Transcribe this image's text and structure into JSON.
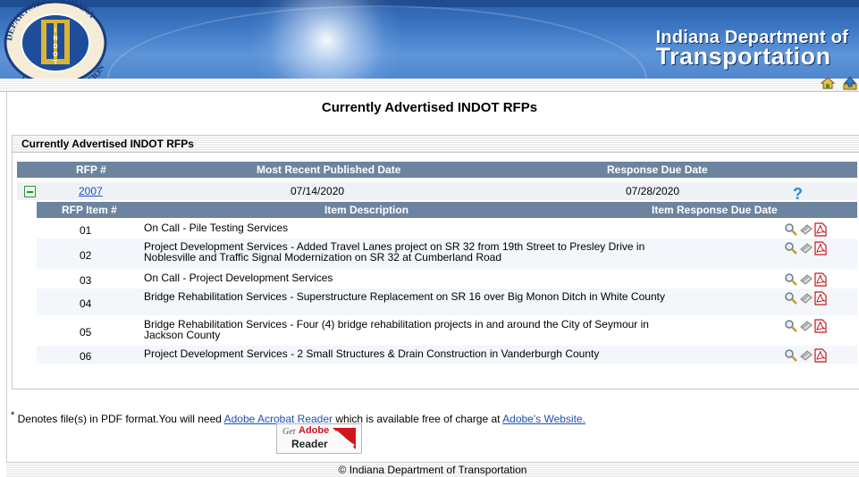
{
  "banner": {
    "title_line1": "Indiana Department of",
    "title_line2": "Transportation",
    "seal_text_top": "INDIANA",
    "seal_text_bottom": "OF TRANSPORTATION",
    "seal_text_left": "DEPARTMENT",
    "seal_center": "INDOT",
    "icons": [
      "home-icon",
      "up-arrow-icon"
    ]
  },
  "page_title": "Currently Advertised INDOT RFPs",
  "panel": {
    "heading": "Currently Advertised INDOT RFPs",
    "columns": {
      "rfp": "RFP #",
      "published": "Most Recent Published Date",
      "due": "Response Due Date"
    },
    "rfp": {
      "number": "2007",
      "published": "07/14/2020",
      "due": "07/28/2020",
      "help_icon": "question-icon"
    },
    "item_columns": {
      "item": "RFP Item #",
      "description": "Item Description",
      "due": "Item Response Due Date"
    },
    "items": [
      {
        "num": "01",
        "desc": "On Call - Pile Testing Services"
      },
      {
        "num": "02",
        "desc": "Project Development Services - Added Travel Lanes project on SR 32 from 19th Street to Presley Drive in Noblesville and Traffic Signal Modernization on SR 32 at Cumberland Road"
      },
      {
        "num": "03",
        "desc": "On Call - Project Development Services"
      },
      {
        "num": "04",
        "desc": "Bridge Rehabilitation Services - Superstructure Replacement on SR 16 over Big Monon Ditch in White County"
      },
      {
        "num": "05",
        "desc": "Bridge Rehabilitation Services - Four (4) bridge rehabilitation projects in and around the City of Seymour in Jackson County"
      },
      {
        "num": "06",
        "desc": "Project Development Services - 2 Small Structures & Drain Construction in Vanderburgh County"
      }
    ],
    "row_icons": [
      "magnifier-icon",
      "document-icon",
      "pdf-icon"
    ]
  },
  "note": {
    "asterisk": "*",
    "prefix": " Denotes file(s) in PDF format.You will need ",
    "link1": "Adobe Acrobat Reader",
    "middle": " which is available free of charge at ",
    "link2": "Adobe's Website."
  },
  "reader_badge": {
    "get": "Get",
    "adobe": "Adobe",
    "reader": "Reader"
  },
  "footer": "© Indiana Department of Transportation",
  "colors": {
    "banner": "#3d77c4",
    "header_row": "#6c84a0",
    "link": "#1b4fb8"
  }
}
